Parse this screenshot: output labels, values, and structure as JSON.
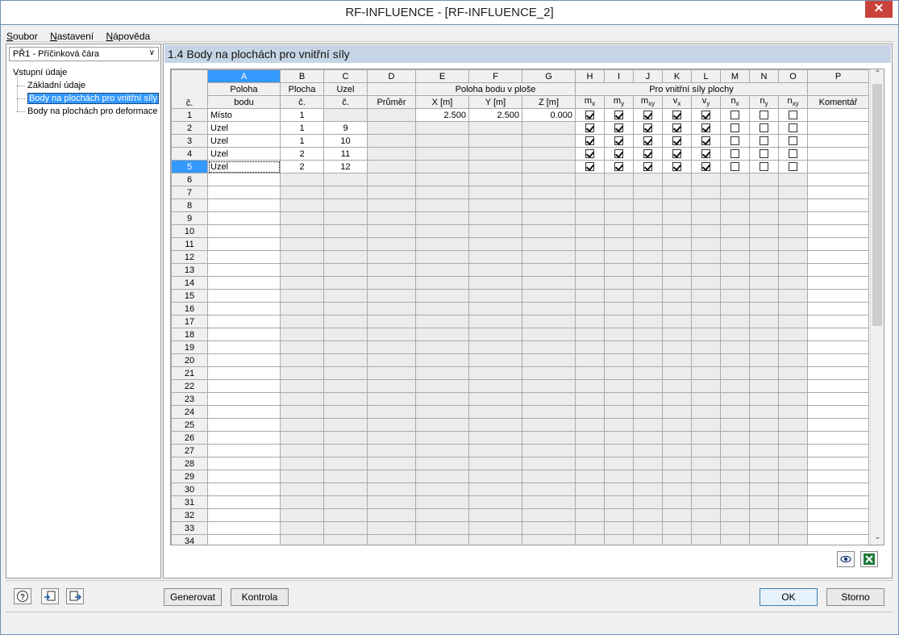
{
  "window": {
    "title": "RF-INFLUENCE - [RF-INFLUENCE_2]",
    "close_glyph": "✕"
  },
  "menu": {
    "items": [
      {
        "mnemonic": "S",
        "rest": "oubor"
      },
      {
        "mnemonic": "N",
        "rest": "astavení"
      },
      {
        "mnemonic": "N",
        "rest": "ápověda"
      }
    ]
  },
  "left": {
    "combo_value": "PŘ1 - Příčinková čára",
    "tree_root": "Vstupní údaje",
    "tree_items": [
      "Základní údaje",
      "Body na plochách pro vnitřní síly",
      "Body na plochách pro deformace"
    ],
    "selected_index": 1
  },
  "panel": {
    "title": "1.4 Body na plochách pro vnitřní síly"
  },
  "grid": {
    "col_letters": [
      "A",
      "B",
      "C",
      "D",
      "E",
      "F",
      "G",
      "H",
      "I",
      "J",
      "K",
      "L",
      "M",
      "N",
      "O",
      "P"
    ],
    "header": {
      "row_col": "č.",
      "a1": "Poloha",
      "a2": "bodu",
      "b1": "Plocha",
      "b2": "č.",
      "c1": "Uzel",
      "c2": "č.",
      "d2": "Průměr",
      "efg": "Poloha bodu v ploše",
      "e": "X [m]",
      "f": "Y [m]",
      "g": "Z [m]",
      "forces": "Pro vnitřní síly plochy",
      "p2": "Komentář"
    },
    "force_cols": [
      {
        "base": "m",
        "sub": "x"
      },
      {
        "base": "m",
        "sub": "y"
      },
      {
        "base": "m",
        "sub": "xy"
      },
      {
        "base": "v",
        "sub": "x"
      },
      {
        "base": "v",
        "sub": "y"
      },
      {
        "base": "n",
        "sub": "x"
      },
      {
        "base": "n",
        "sub": "y"
      },
      {
        "base": "n",
        "sub": "xy"
      }
    ],
    "rows": [
      {
        "no": "1",
        "a": "Místo",
        "b": "1",
        "c": "",
        "d": "",
        "e": "2.500",
        "f": "2.500",
        "g": "0.000",
        "checks": [
          true,
          true,
          true,
          true,
          true,
          false,
          false,
          false
        ],
        "p": ""
      },
      {
        "no": "2",
        "a": "Uzel",
        "b": "1",
        "c": "9",
        "d": "",
        "e": "",
        "f": "",
        "g": "",
        "checks": [
          true,
          true,
          true,
          true,
          true,
          false,
          false,
          false
        ],
        "p": ""
      },
      {
        "no": "3",
        "a": "Uzel",
        "b": "1",
        "c": "10",
        "d": "",
        "e": "",
        "f": "",
        "g": "",
        "checks": [
          true,
          true,
          true,
          true,
          true,
          false,
          false,
          false
        ],
        "p": ""
      },
      {
        "no": "4",
        "a": "Uzel",
        "b": "2",
        "c": "11",
        "d": "",
        "e": "",
        "f": "",
        "g": "",
        "checks": [
          true,
          true,
          true,
          true,
          true,
          false,
          false,
          false
        ],
        "p": ""
      },
      {
        "no": "5",
        "a": "Uzel",
        "b": "2",
        "c": "12",
        "d": "",
        "e": "",
        "f": "",
        "g": "",
        "checks": [
          true,
          true,
          true,
          true,
          true,
          false,
          false,
          false
        ],
        "p": ""
      }
    ],
    "empty_rows": [
      "6",
      "7",
      "8",
      "9",
      "10",
      "11",
      "12",
      "13",
      "14",
      "15",
      "16",
      "17",
      "18",
      "19",
      "20",
      "21",
      "22",
      "23",
      "24",
      "25",
      "26",
      "27",
      "28",
      "29",
      "30",
      "31",
      "32",
      "33",
      "34"
    ],
    "selected_row": "5",
    "scroll_up": "⌃",
    "scroll_down": "⌄"
  },
  "grid_tools": {
    "view_icon": "eye-icon",
    "excel_icon": "excel-icon"
  },
  "bottom": {
    "help_icon": "help-icon",
    "import_icon": "import-icon",
    "export_icon": "export-icon",
    "generate": "Generovat",
    "check": "Kontrola",
    "ok": "OK",
    "cancel": "Storno"
  }
}
